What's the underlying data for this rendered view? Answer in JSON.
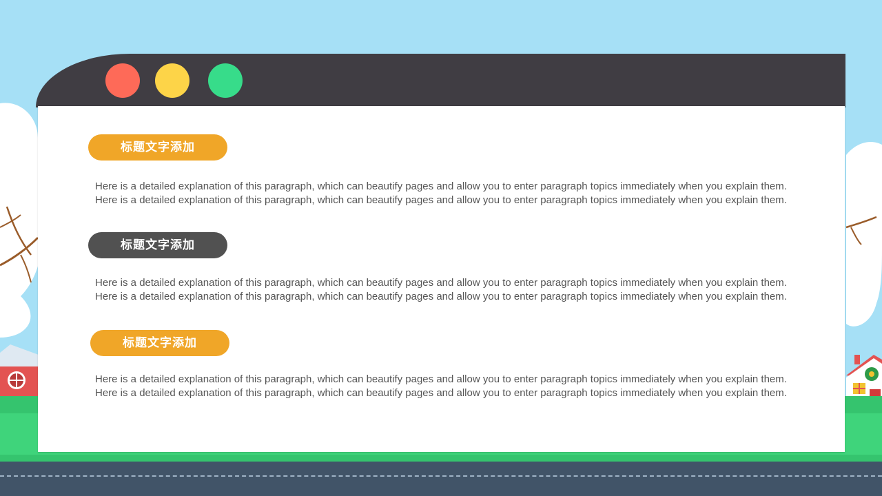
{
  "sections": [
    {
      "title": "标题文字添加",
      "body": "Here is a detailed explanation of this paragraph, which can beautify pages and allow you to enter paragraph topics immediately when you explain them. Here is a detailed explanation of this paragraph, which can beautify pages and allow you to enter paragraph topics immediately when you explain them."
    },
    {
      "title": "标题文字添加",
      "body": "Here is a detailed explanation of this paragraph, which can beautify pages and allow you to enter paragraph topics immediately when you explain them. Here is a detailed explanation of this paragraph, which can beautify pages and allow you to enter paragraph topics immediately when you explain them."
    },
    {
      "title": "标题文字添加",
      "body": "Here is a detailed explanation of this paragraph, which can beautify pages and allow you to enter paragraph topics immediately when you explain them. Here is a detailed explanation of this paragraph, which can beautify pages and allow you to enter paragraph topics immediately when you explain them."
    }
  ],
  "colors": {
    "sky": "#a6e0f6",
    "window_bar": "#403d43",
    "dot_red": "#fe6a58",
    "dot_yellow": "#fdd448",
    "dot_green": "#37dc8a",
    "pill_orange": "#f0a628",
    "pill_gray": "#515151",
    "grass": "#35c46e",
    "road": "#415468"
  },
  "icons": [
    "tree-icon",
    "house-icon"
  ]
}
